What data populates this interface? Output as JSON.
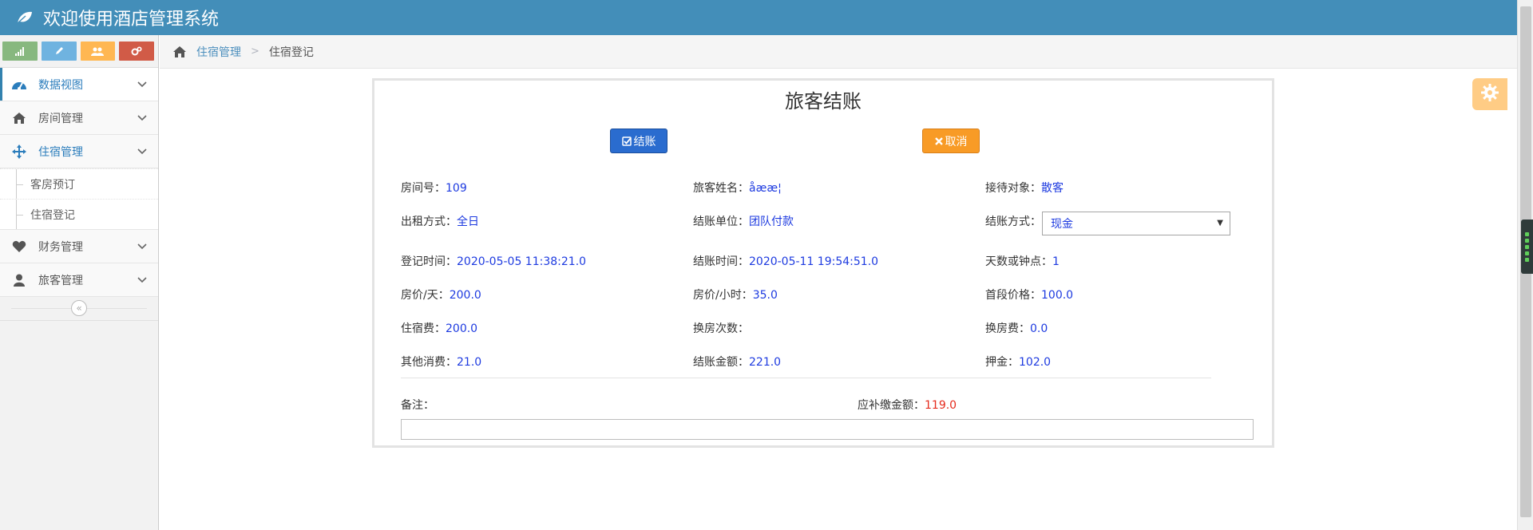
{
  "app": {
    "title": "欢迎使用酒店管理系统"
  },
  "sidebar": {
    "shortcuts": [
      {
        "icon": "signal-icon",
        "color": "#87b87f"
      },
      {
        "icon": "pencil-icon",
        "color": "#6fb3e0"
      },
      {
        "icon": "users-icon",
        "color": "#ffb752"
      },
      {
        "icon": "cogs-icon",
        "color": "#d15b47"
      }
    ],
    "items": [
      {
        "label": "数据视图",
        "icon": "dashboard-icon"
      },
      {
        "label": "房间管理",
        "icon": "home-icon"
      },
      {
        "label": "住宿管理",
        "icon": "move-icon"
      },
      {
        "label": "财务管理",
        "icon": "heart-icon"
      },
      {
        "label": "旅客管理",
        "icon": "user-icon"
      }
    ],
    "subitems": [
      {
        "label": "客房预订"
      },
      {
        "label": "住宿登记"
      }
    ],
    "collapse_glyph": "«"
  },
  "breadcrumb": {
    "parent": "住宿管理",
    "separator": ">",
    "current": "住宿登记"
  },
  "checkout": {
    "title": "旅客结账",
    "confirm_label": "结账",
    "cancel_label": "取消",
    "room_no": {
      "label": "房间号：",
      "value": "109"
    },
    "guest_name": {
      "label": "旅客姓名：",
      "value": "åææ¦"
    },
    "reception": {
      "label": "接待对象：",
      "value": "散客"
    },
    "rent_mode": {
      "label": "出租方式：",
      "value": "全日"
    },
    "pay_unit": {
      "label": "结账单位：",
      "value": "团队付款"
    },
    "pay_method": {
      "label": "结账方式：",
      "value": "现金"
    },
    "checkin_time": {
      "label": "登记时间：",
      "value": "2020-05-05 11:38:21.0"
    },
    "checkout_time": {
      "label": "结账时间：",
      "value": "2020-05-11 19:54:51.0"
    },
    "days": {
      "label": "天数或钟点：",
      "value": "1"
    },
    "price_day": {
      "label": "房价/天：",
      "value": "200.0"
    },
    "price_hour": {
      "label": "房价/小时：",
      "value": "35.0"
    },
    "first_price": {
      "label": "首段价格：",
      "value": "100.0"
    },
    "stay_fee": {
      "label": "住宿费：",
      "value": "200.0"
    },
    "change_count": {
      "label": "换房次数：",
      "value": ""
    },
    "change_fee": {
      "label": "换房费：",
      "value": "0.0"
    },
    "other_fee": {
      "label": "其他消费：",
      "value": "21.0"
    },
    "total": {
      "label": "结账金额：",
      "value": "221.0"
    },
    "deposit": {
      "label": "押金：",
      "value": "102.0"
    },
    "remark_label": "备注：",
    "due": {
      "label": "应补缴金额：",
      "value": "119.0"
    }
  },
  "colors": {
    "navbar": "#438eb9",
    "value_text": "#1e3be0",
    "due_text": "#e52b1d"
  }
}
